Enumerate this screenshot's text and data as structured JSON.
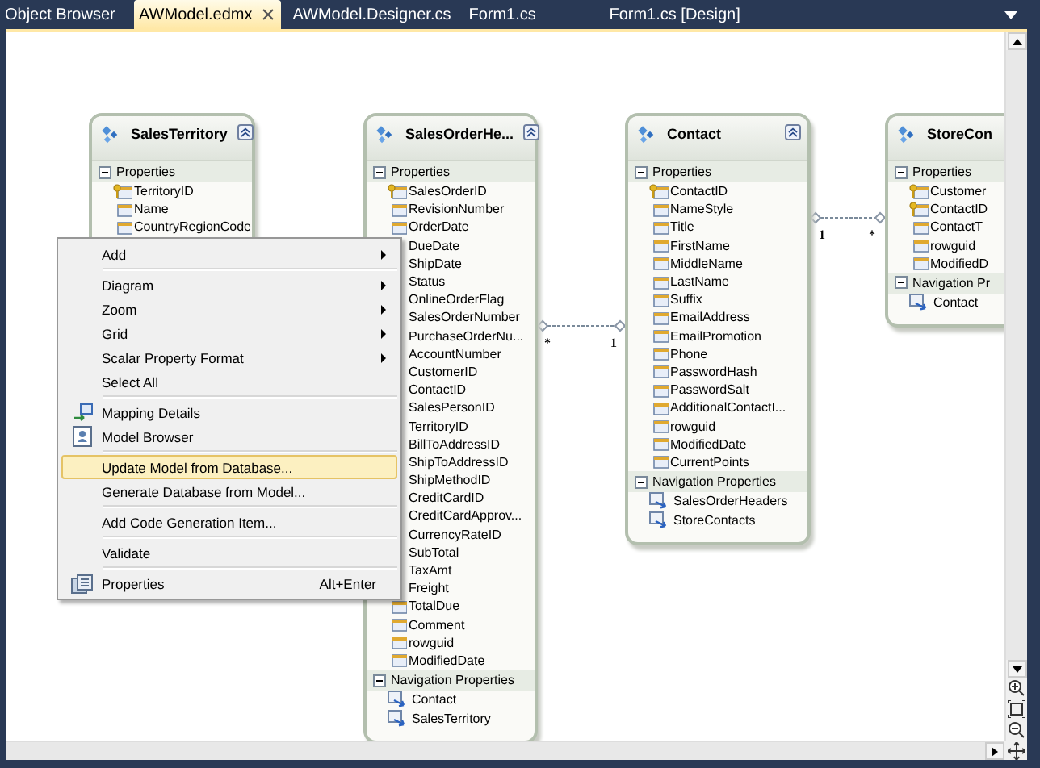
{
  "tabs": [
    {
      "label": "Object Browser",
      "selected": false
    },
    {
      "label": "AWModel.edmx",
      "selected": true
    },
    {
      "label": "AWModel.Designer.cs",
      "selected": false
    },
    {
      "label": "Form1.cs",
      "selected": false
    },
    {
      "label": "Form1.cs [Design]",
      "selected": false
    }
  ],
  "entities": [
    {
      "title": "SalesTerritory",
      "properties_label": "Properties",
      "properties": [
        {
          "name": "TerritoryID",
          "key": true
        },
        {
          "name": "Name",
          "key": false
        },
        {
          "name": "CountryRegionCode",
          "key": false
        }
      ]
    },
    {
      "title": "SalesOrderHe...",
      "properties_label": "Properties",
      "properties": [
        {
          "name": "SalesOrderID",
          "key": true
        },
        {
          "name": "RevisionNumber",
          "key": false
        },
        {
          "name": "OrderDate",
          "key": false
        },
        {
          "name": "DueDate"
        },
        {
          "name": "ShipDate"
        },
        {
          "name": "Status"
        },
        {
          "name": "OnlineOrderFlag"
        },
        {
          "name": "SalesOrderNumber"
        },
        {
          "name": "PurchaseOrderNu..."
        },
        {
          "name": "AccountNumber"
        },
        {
          "name": "CustomerID"
        },
        {
          "name": "ContactID"
        },
        {
          "name": "SalesPersonID"
        },
        {
          "name": "TerritoryID"
        },
        {
          "name": "BillToAddressID"
        },
        {
          "name": "ShipToAddressID"
        },
        {
          "name": "ShipMethodID"
        },
        {
          "name": "CreditCardID"
        },
        {
          "name": "CreditCardApprov..."
        },
        {
          "name": "CurrencyRateID"
        },
        {
          "name": "SubTotal"
        },
        {
          "name": "TaxAmt"
        },
        {
          "name": "Freight"
        },
        {
          "name": "TotalDue",
          "key": false
        },
        {
          "name": "Comment",
          "key": false
        },
        {
          "name": "rowguid",
          "key": false
        },
        {
          "name": "ModifiedDate",
          "key": false
        }
      ],
      "navigation_label": "Navigation Properties",
      "navigation": [
        "Contact",
        "SalesTerritory"
      ]
    },
    {
      "title": "Contact",
      "properties_label": "Properties",
      "properties": [
        {
          "name": "ContactID",
          "key": true
        },
        {
          "name": "NameStyle",
          "key": false
        },
        {
          "name": "Title",
          "key": false
        },
        {
          "name": "FirstName",
          "key": false
        },
        {
          "name": "MiddleName",
          "key": false
        },
        {
          "name": "LastName",
          "key": false
        },
        {
          "name": "Suffix",
          "key": false
        },
        {
          "name": "EmailAddress",
          "key": false
        },
        {
          "name": "EmailPromotion",
          "key": false
        },
        {
          "name": "Phone",
          "key": false
        },
        {
          "name": "PasswordHash",
          "key": false
        },
        {
          "name": "PasswordSalt",
          "key": false
        },
        {
          "name": "AdditionalContactI...",
          "key": false
        },
        {
          "name": "rowguid",
          "key": false
        },
        {
          "name": "ModifiedDate",
          "key": false
        },
        {
          "name": "CurrentPoints",
          "key": false
        }
      ],
      "navigation_label": "Navigation Properties",
      "navigation": [
        "SalesOrderHeaders",
        "StoreContacts"
      ]
    },
    {
      "title": "StoreCon",
      "properties_label": "Properties",
      "properties": [
        {
          "name": "Customer",
          "key": true
        },
        {
          "name": "ContactID",
          "key": true
        },
        {
          "name": "ContactT",
          "key": false
        },
        {
          "name": "rowguid",
          "key": false
        },
        {
          "name": "ModifiedD",
          "key": false
        }
      ],
      "navigation_label": "Navigation Pr",
      "navigation": [
        "Contact"
      ]
    }
  ],
  "associations": [
    {
      "end_1": "*",
      "end_2": "1"
    },
    {
      "end_1": "1",
      "end_2": "*"
    }
  ],
  "context_menu": {
    "items": [
      {
        "kind": "item",
        "label": "Add",
        "submenu": true,
        "selected": false
      },
      {
        "kind": "separator"
      },
      {
        "kind": "item",
        "label": "Diagram",
        "submenu": true,
        "selected": false
      },
      {
        "kind": "item",
        "label": "Zoom",
        "submenu": true,
        "selected": false
      },
      {
        "kind": "item",
        "label": "Grid",
        "submenu": true,
        "selected": false
      },
      {
        "kind": "item",
        "label": "Scalar Property Format",
        "submenu": true,
        "selected": false
      },
      {
        "kind": "item",
        "label": "Select All",
        "submenu": false,
        "selected": false
      },
      {
        "kind": "separator"
      },
      {
        "kind": "item",
        "label": "Mapping Details",
        "submenu": false,
        "selected": false
      },
      {
        "kind": "item",
        "label": "Model Browser",
        "submenu": false,
        "selected": false
      },
      {
        "kind": "separator"
      },
      {
        "kind": "item",
        "label": "Update Model from Database...",
        "submenu": false,
        "selected": true
      },
      {
        "kind": "item",
        "label": "Generate Database from Model...",
        "submenu": false,
        "selected": false
      },
      {
        "kind": "separator"
      },
      {
        "kind": "item",
        "label": "Add Code Generation Item...",
        "submenu": false,
        "selected": false
      },
      {
        "kind": "separator"
      },
      {
        "kind": "item",
        "label": "Validate",
        "submenu": false,
        "selected": false
      },
      {
        "kind": "separator"
      },
      {
        "kind": "item",
        "label": "Properties",
        "submenu": false,
        "selected": false,
        "shortcut": "Alt+Enter"
      }
    ]
  }
}
